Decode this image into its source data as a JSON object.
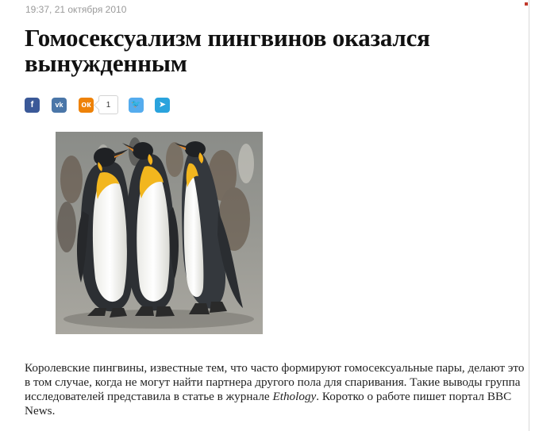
{
  "article": {
    "timestamp": "19:37, 21 октября 2010",
    "title": "Гомосексуализм пингвинов оказался вынужденным",
    "body_part1": "Королевские пингвины, известные тем, что часто формируют гомосексуальные пары, делают это в том случае, когда не могут найти партнера другого пола для спаривания. Такие выводы группа исследователей представила в статье в журнале ",
    "body_journal": "Ethology",
    "body_part2": ". Коротко о работе пишет портал BBC News."
  },
  "share": {
    "facebook_icon": "f",
    "vk_icon": "vk",
    "ok_icon": "ок",
    "ok_count": "1",
    "twitter_icon": "🐦",
    "telegram_icon": "➤"
  },
  "colors": {
    "facebook": "#3b5998",
    "vk": "#4a76a8",
    "odnoklassniki": "#ee8208",
    "twitter": "#55acee",
    "telegram": "#2aa3dd",
    "title": "#111111",
    "timestamp": "#9a9a9a"
  },
  "image": {
    "icon": "king-penguins-photo"
  }
}
